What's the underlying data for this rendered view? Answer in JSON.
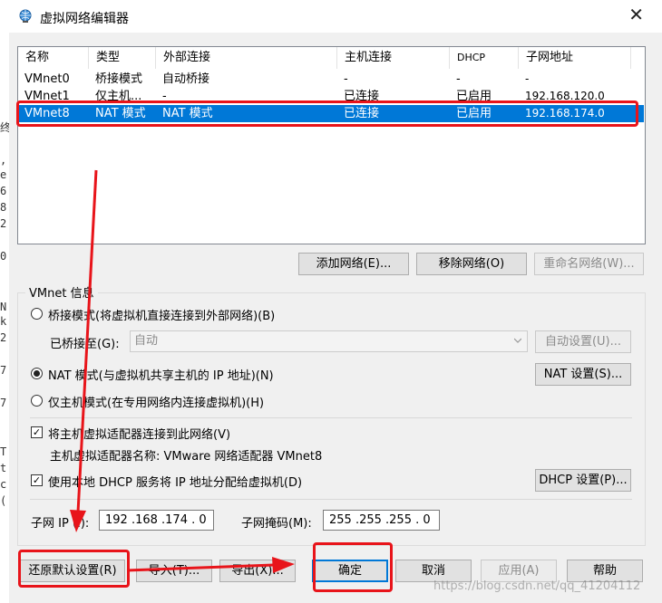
{
  "window": {
    "title": "虚拟网络编辑器",
    "close_label": "✕"
  },
  "left_strip_chars": [
    "终",
    ",",
    "e",
    "6",
    "8",
    "2",
    "0",
    "N",
    "k",
    "2",
    "7",
    "7",
    "T",
    "t",
    "c",
    "("
  ],
  "table": {
    "columns": [
      "名称",
      "类型",
      "外部连接",
      "主机连接",
      "DHCP",
      "子网地址"
    ],
    "rows": [
      [
        "VMnet0",
        "桥接模式",
        "自动桥接",
        "-",
        "-",
        "-"
      ],
      [
        "VMnet1",
        "仅主机...",
        "-",
        "已连接",
        "已启用",
        "192.168.120.0"
      ],
      [
        "VMnet8",
        "NAT 模式",
        "NAT 模式",
        "已连接",
        "已启用",
        "192.168.174.0"
      ]
    ],
    "selected_row": 2
  },
  "list_buttons": {
    "add": "添加网络(E)...",
    "remove": "移除网络(O)",
    "rename": "重命名网络(W)..."
  },
  "vmnet_info": {
    "group_label": "VMnet 信息",
    "bridge_radio": "桥接模式(将虚拟机直接连接到外部网络)(B)",
    "bridged_to_label": "已桥接至(G):",
    "bridged_to_value": "自动",
    "auto_settings": "自动设置(U)...",
    "nat_radio": "NAT 模式(与虚拟机共享主机的 IP 地址)(N)",
    "nat_settings": "NAT 设置(S)...",
    "hostonly_radio": "仅主机模式(在专用网络内连接虚拟机)(H)",
    "connect_adapter_check": "将主机虚拟适配器连接到此网络(V)",
    "adapter_name": "主机虚拟适配器名称: VMware 网络适配器 VMnet8",
    "dhcp_check": "使用本地 DHCP 服务将 IP 地址分配给虚拟机(D)",
    "dhcp_settings": "DHCP 设置(P)...",
    "subnet_ip_label": "子网 IP (I):",
    "subnet_ip_value": "192 .168 .174 . 0",
    "subnet_mask_label": "子网掩码(M):",
    "subnet_mask_value": "255 .255 .255 . 0"
  },
  "bottom_buttons": {
    "restore": "还原默认设置(R)",
    "import": "导入(T)...",
    "export": "导出(X)...",
    "ok": "确定",
    "cancel": "取消",
    "apply": "应用(A)",
    "help": "帮助"
  },
  "watermark": "https://blog.csdn.net/qq_41204112",
  "colors": {
    "selection": "#0078d7",
    "annotation": "#e8141a"
  }
}
